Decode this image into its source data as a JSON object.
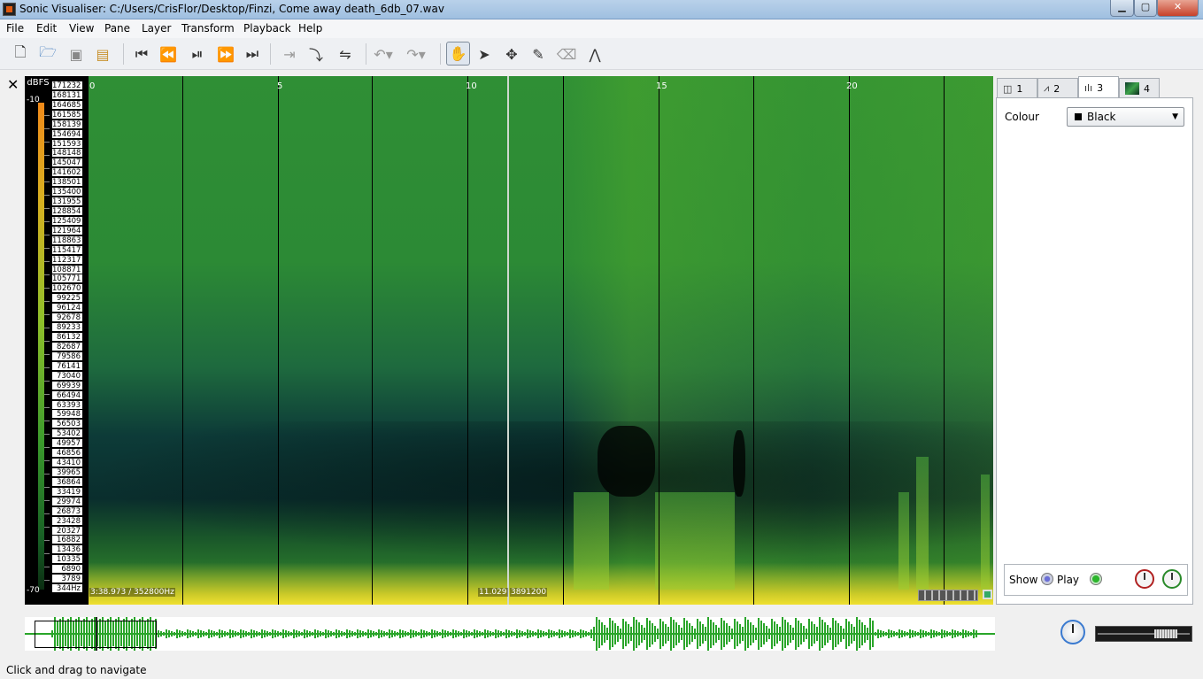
{
  "window": {
    "title": "Sonic Visualiser: C:/Users/CrisFlor/Desktop/Finzi, Come away death_6db_07.wav",
    "min_icon": "minimize-icon",
    "max_icon": "maximize-icon",
    "close_symbol": "✕"
  },
  "menu": [
    "File",
    "Edit",
    "View",
    "Pane",
    "Layer",
    "Transform",
    "Playback",
    "Help"
  ],
  "toolbar": {
    "file_icons": [
      "new-file-icon",
      "open-folder-icon",
      "save-icon",
      "save-session-icon"
    ],
    "transport_icons": [
      "rewind-start-icon",
      "rewind-icon",
      "play-pause-icon",
      "fast-forward-icon",
      "ffwd-end-icon"
    ],
    "play_option_icons": [
      "play-selection-icon",
      "follow-playback-icon",
      "loop-icon"
    ],
    "edit_icons": [
      "undo-icon",
      "redo-icon"
    ],
    "tool_icons": [
      "navigate-hand-icon",
      "select-arrow-icon",
      "move-icon",
      "draw-pencil-icon",
      "erase-icon",
      "measure-icon"
    ]
  },
  "pane": {
    "close_symbol": "✕",
    "db_label": "dBFS",
    "db_top": "-10",
    "db_bottom": "-70",
    "freq_labels": [
      "171232",
      "168131",
      "164685",
      "161585",
      "158139",
      "154694",
      "151593",
      "148148",
      "145047",
      "141602",
      "138501",
      "135400",
      "131955",
      "128854",
      "125409",
      "121964",
      "118863",
      "115417",
      "112317",
      "108871",
      "105771",
      "102670",
      "99225",
      "96124",
      "92678",
      "89233",
      "86132",
      "82687",
      "79586",
      "76141",
      "73040",
      "69939",
      "66494",
      "63393",
      "59948",
      "56503",
      "53402",
      "49957",
      "46856",
      "43410",
      "39965",
      "36864",
      "33419",
      "29974",
      "26873",
      "23428",
      "20327",
      "16882",
      "13436",
      "10335",
      "6890",
      "3789",
      "344Hz"
    ],
    "time_labels": [
      {
        "text": "0",
        "t": 0
      },
      {
        "text": "5",
        "t": 5
      },
      {
        "text": "10",
        "t": 10
      },
      {
        "text": "15",
        "t": 15
      },
      {
        "text": "20",
        "t": 20
      }
    ],
    "position_readout": "3:38.973 / 352800Hz",
    "playhead_time": "11.029",
    "playhead_frame": "3891200",
    "colours": {
      "accent_green": "#2aa52a",
      "playhead": "#cfd8cf"
    }
  },
  "properties": {
    "tabs": [
      {
        "label": "1",
        "icon": "pane-layout-icon",
        "active": false
      },
      {
        "label": "2",
        "icon": "waveform-icon",
        "active": false
      },
      {
        "label": "3",
        "icon": "time-ruler-icon",
        "active": true
      },
      {
        "label": "4",
        "icon": "spectrogram-thumbnail-icon",
        "active": false
      }
    ],
    "colour_label": "Colour",
    "colour_value": "Black",
    "show_label": "Show",
    "play_label": "Play"
  },
  "status": "Click and drag to navigate"
}
